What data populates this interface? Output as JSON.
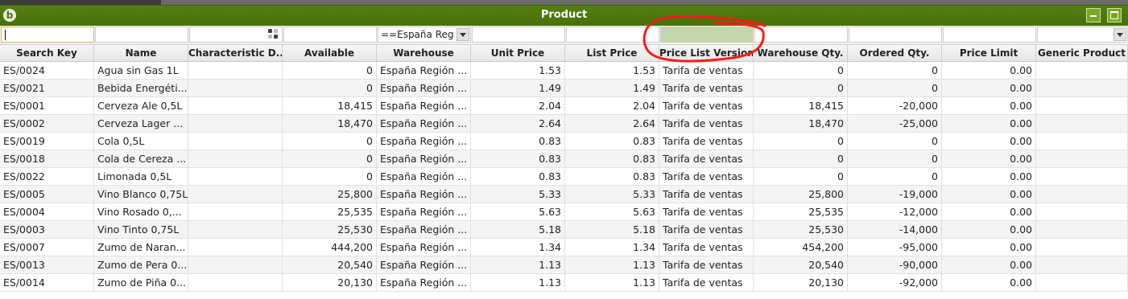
{
  "window": {
    "title": "Product"
  },
  "colors": {
    "titlebar": "#4d770d",
    "annotation": "#ff1a1a",
    "highlight_filter": "#c7d5ae"
  },
  "filters": {
    "warehouse_value": "==España Reg"
  },
  "columns": [
    "Search Key",
    "Name",
    "Characteristic D...",
    "Available",
    "Warehouse",
    "Unit Price",
    "List Price",
    "Price List Version",
    "Warehouse Qty.",
    "Ordered Qty.",
    "Price Limit",
    "Generic Product"
  ],
  "rows": [
    [
      "ES/0024",
      "Agua sin Gas 1L",
      "",
      "0",
      "España Región ...",
      "1.53",
      "1.53",
      "Tarifa de ventas",
      "0",
      "0",
      "0.00",
      ""
    ],
    [
      "ES/0021",
      "Bebida Energéti...",
      "",
      "0",
      "España Región ...",
      "1.49",
      "1.49",
      "Tarifa de ventas",
      "0",
      "0",
      "0.00",
      ""
    ],
    [
      "ES/0001",
      "Cerveza Ale 0,5L",
      "",
      "18,415",
      "España Región ...",
      "2.04",
      "2.04",
      "Tarifa de ventas",
      "18,415",
      "-20,000",
      "0.00",
      ""
    ],
    [
      "ES/0002",
      "Cerveza Lager ...",
      "",
      "18,470",
      "España Región ...",
      "2.64",
      "2.64",
      "Tarifa de ventas",
      "18,470",
      "-25,000",
      "0.00",
      ""
    ],
    [
      "ES/0019",
      "Cola 0,5L",
      "",
      "0",
      "España Región ...",
      "0.83",
      "0.83",
      "Tarifa de ventas",
      "0",
      "0",
      "0.00",
      ""
    ],
    [
      "ES/0018",
      "Cola de Cereza ...",
      "",
      "0",
      "España Región ...",
      "0.83",
      "0.83",
      "Tarifa de ventas",
      "0",
      "0",
      "0.00",
      ""
    ],
    [
      "ES/0022",
      "Limonada 0,5L",
      "",
      "0",
      "España Región ...",
      "0.83",
      "0.83",
      "Tarifa de ventas",
      "0",
      "0",
      "0.00",
      ""
    ],
    [
      "ES/0005",
      "Vino Blanco 0,75L",
      "",
      "25,800",
      "España Región ...",
      "5.33",
      "5.33",
      "Tarifa de ventas",
      "25,800",
      "-19,000",
      "0.00",
      ""
    ],
    [
      "ES/0004",
      "Vino Rosado 0,...",
      "",
      "25,535",
      "España Región ...",
      "5.63",
      "5.63",
      "Tarifa de ventas",
      "25,535",
      "-12,000",
      "0.00",
      ""
    ],
    [
      "ES/0003",
      "Vino Tinto 0,75L",
      "",
      "25,530",
      "España Región ...",
      "5.18",
      "5.18",
      "Tarifa de ventas",
      "25,530",
      "-14,000",
      "0.00",
      ""
    ],
    [
      "ES/0007",
      "Zumo de Naran...",
      "",
      "444,200",
      "España Región ...",
      "1.34",
      "1.34",
      "Tarifa de ventas",
      "454,200",
      "-95,000",
      "0.00",
      ""
    ],
    [
      "ES/0013",
      "Zumo de Pera 0...",
      "",
      "20,540",
      "España Región ...",
      "1.13",
      "1.13",
      "Tarifa de ventas",
      "20,540",
      "-90,000",
      "0.00",
      ""
    ],
    [
      "ES/0014",
      "Zumo de Piña 0...",
      "",
      "20,130",
      "España Región ...",
      "1.13",
      "1.13",
      "Tarifa de ventas",
      "20,130",
      "-92,000",
      "0.00",
      ""
    ]
  ]
}
